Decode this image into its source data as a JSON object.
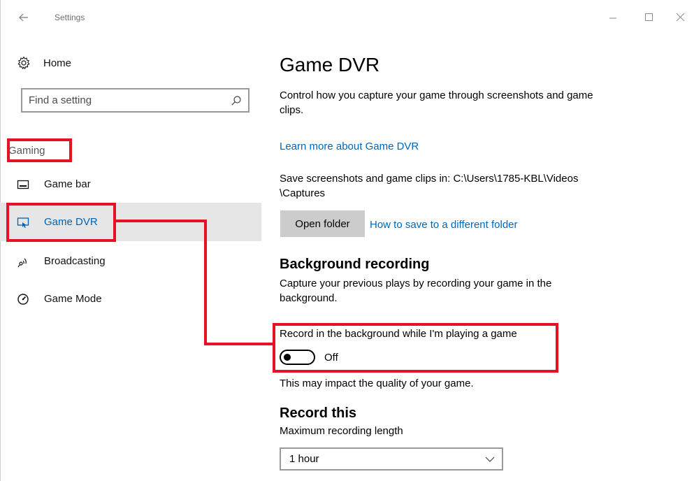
{
  "titlebar": {
    "title": "Settings"
  },
  "sidebar": {
    "home_label": "Home",
    "search": {
      "placeholder": "Find a setting"
    },
    "section_label": "Gaming",
    "items": [
      {
        "label": "Game bar",
        "icon": "game-bar-icon"
      },
      {
        "label": "Game DVR",
        "icon": "game-dvr-icon",
        "active": true
      },
      {
        "label": "Broadcasting",
        "icon": "broadcasting-icon"
      },
      {
        "label": "Game Mode",
        "icon": "game-mode-icon"
      }
    ]
  },
  "main": {
    "title": "Game DVR",
    "description": "Control how you capture your game through screenshots and game clips.",
    "learn_more_link": "Learn more about Game DVR",
    "save_path_text": "Save screenshots and game clips in: C:\\Users\\1785-KBL\\Videos \\Captures",
    "open_folder_label": "Open folder",
    "folder_help_link": "How to save to a different folder",
    "background": {
      "heading": "Background recording",
      "description": "Capture your previous plays by recording your game in the background.",
      "toggle_label": "Record in the background while I'm playing a game",
      "toggle_state": "Off",
      "impact_note": "This may impact the quality of your game."
    },
    "record_this": {
      "heading": "Record this",
      "max_length_label": "Maximum recording length",
      "max_length_value": "1 hour"
    }
  },
  "colors": {
    "accent": "#0063b1",
    "link": "#0067b8",
    "highlight": "#e81123",
    "active_bg": "#e6e6e6"
  }
}
